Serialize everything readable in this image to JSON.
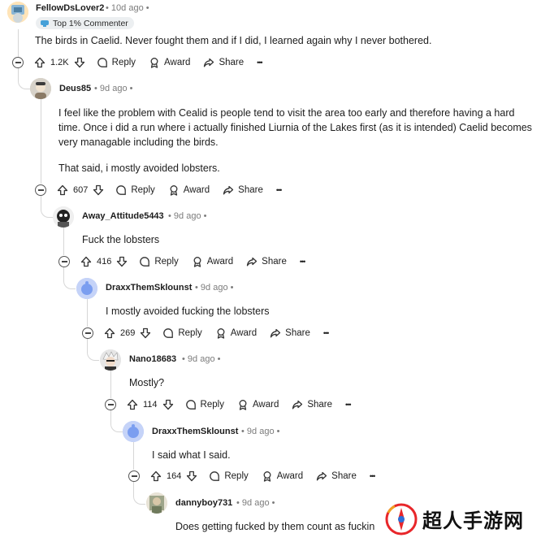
{
  "labels": {
    "reply": "Reply",
    "award": "Award",
    "share": "Share",
    "more": "•••"
  },
  "comments": [
    {
      "user": "FellowDsLover2",
      "time": "10d ago",
      "flair": "Top 1% Commenter",
      "body": [
        "The birds in Caelid. Never fought them and if I did, I learned again why I never bothered."
      ],
      "votes": "1.2K"
    },
    {
      "user": "Deus85",
      "time": "9d ago",
      "body": [
        "I feel like the problem with Cealid is people tend to visit the area too early and therefore having a hard time. Once i did a run where i actually finished Liurnia of the Lakes first (as it is intended) Caelid becomes very managable including the birds.",
        "That said, i mostly avoided lobsters."
      ],
      "votes": "607"
    },
    {
      "user": "Away_Attitude5443",
      "time": "9d ago",
      "body": [
        "Fuck the lobsters"
      ],
      "votes": "416"
    },
    {
      "user": "DraxxThemSklounst",
      "time": "9d ago",
      "body": [
        "I mostly avoided fucking the lobsters"
      ],
      "votes": "269"
    },
    {
      "user": "Nano18683",
      "time": "9d ago",
      "body": [
        "Mostly?"
      ],
      "votes": "114"
    },
    {
      "user": "DraxxThemSklounst",
      "time": "9d ago",
      "body": [
        "I said what I said."
      ],
      "votes": "164"
    },
    {
      "user": "dannyboy731",
      "time": "9d ago",
      "body": [
        "Does getting fucked by them count as fuckin"
      ]
    }
  ],
  "watermark": {
    "text": "超人手游网"
  },
  "colors": {
    "meta": "#7c7c7c",
    "thread_line": "#d6d6d6",
    "watermark_red": "#e8262a",
    "snoo_blue": "#7b9ef0"
  },
  "icons": [
    "upvote-icon",
    "downvote-icon",
    "reply-icon",
    "award-icon",
    "share-icon",
    "more-icon",
    "collapse-icon"
  ]
}
